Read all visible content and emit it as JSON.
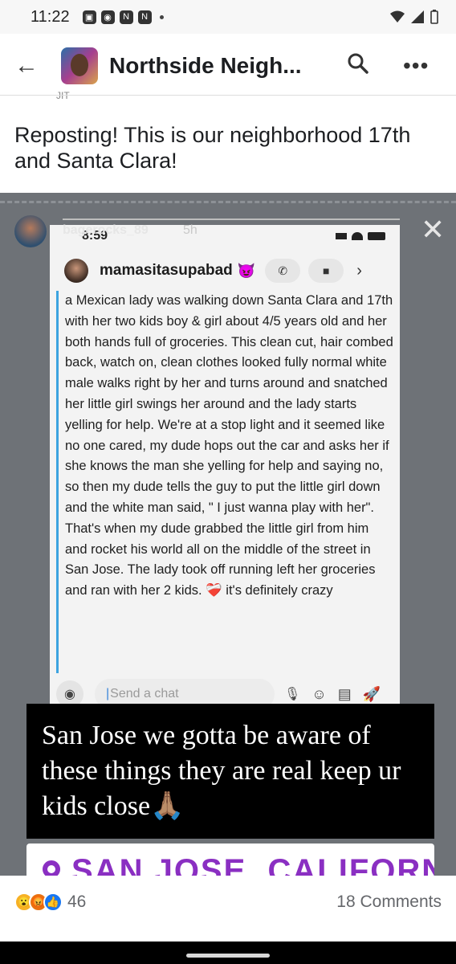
{
  "status_bar": {
    "time": "11:22"
  },
  "header": {
    "back_icon": "arrow-left",
    "group_name": "Northside Neigh...",
    "search_icon": "search",
    "more_icon": "more-horizontal",
    "partial_text": "JIT"
  },
  "post": {
    "text": "Reposting! This is our neighborhood 17th and Santa Clara!"
  },
  "story": {
    "username": "bagerocks_89",
    "age": "5h",
    "close_icon": "close",
    "screenshot": {
      "time": "8:59",
      "chat_name": "mamasitasupabad",
      "chat_emoji": "😈",
      "message": "a Mexican lady was walking down Santa Clara and 17th with her two kids boy & girl about 4/5 years old and her both hands full of groceries. This clean cut, hair combed back, watch on, clean clothes looked fully normal white male walks right by her and turns around and snatched her little girl swings her around and the lady starts yelling for help. We're at a stop light and it seemed like no one cared, my dude hops out the car and asks her if she knows the man she yelling for help and saying no, so then my dude tells the guy to put the little girl down and the white man said, \" I just wanna play with her\". That's when my dude grabbed the little girl from him and rocket his world all on the middle of the street in San Jose. The lady took off running left her groceries and ran with her 2 kids. ❤️‍🩹 it's definitely crazy",
      "input_placeholder": "Send a chat"
    },
    "banner_text": "San Jose we gotta be aware of these things they are real keep ur kids close🙏🏽",
    "location_sticker": "SAN JOSE, CALIFORNIA"
  },
  "footer": {
    "reaction_count": "46",
    "comments": "18 Comments"
  },
  "colors": {
    "snap_blue": "#3da4e0",
    "location_purple": "#8a2fc2",
    "fb_blue": "#1877f2"
  }
}
